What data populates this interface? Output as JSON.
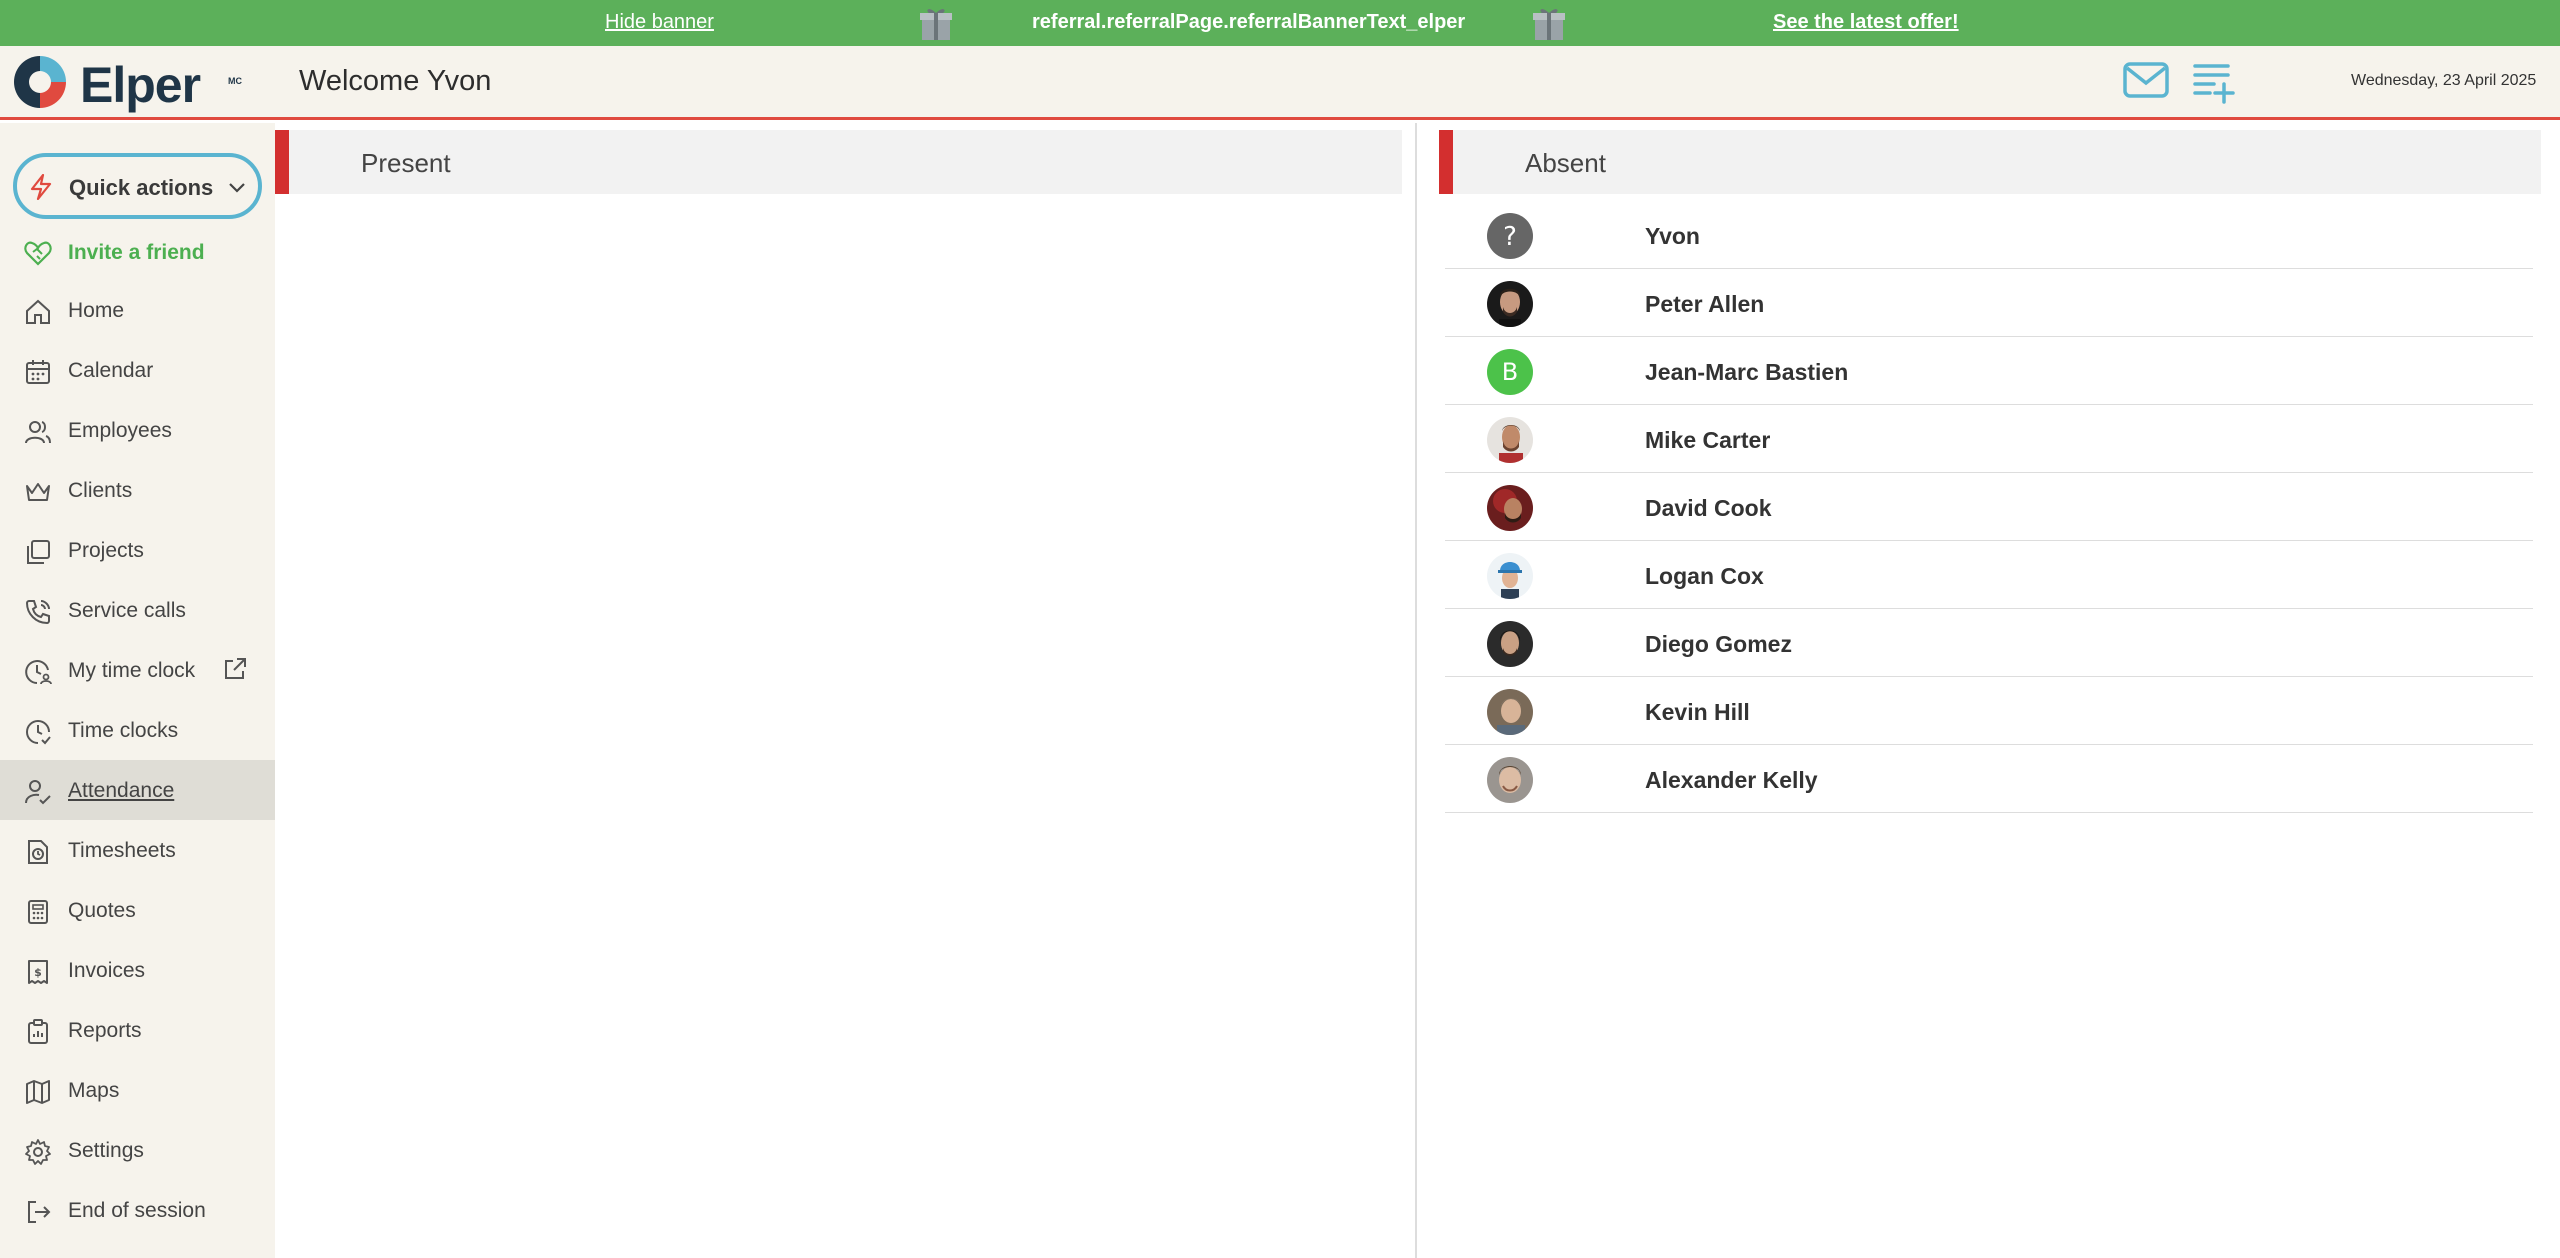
{
  "banner": {
    "hide_label": "Hide banner",
    "text": "referral.referralPage.referralBannerText_elper",
    "offer_label": "See the latest offer!",
    "color": "#5cb05a"
  },
  "header": {
    "logo_text": "Elper",
    "logo_mark": "MC",
    "welcome": "Welcome Yvon",
    "date": "Wednesday, 23 April 2025",
    "icons": [
      "mail-icon",
      "add-list-icon"
    ],
    "accent": "#5ab4d0"
  },
  "sidebar": {
    "quick_actions": "Quick actions",
    "invite": "Invite a friend",
    "items": [
      {
        "label": "Home",
        "icon": "home-icon"
      },
      {
        "label": "Calendar",
        "icon": "calendar-icon"
      },
      {
        "label": "Employees",
        "icon": "users-icon"
      },
      {
        "label": "Clients",
        "icon": "crown-icon"
      },
      {
        "label": "Projects",
        "icon": "folders-icon"
      },
      {
        "label": "Service calls",
        "icon": "phone-icon"
      },
      {
        "label": "My time clock",
        "icon": "clock-user-icon"
      },
      {
        "label": "Time clocks",
        "icon": "clock-icon"
      },
      {
        "label": "Attendance",
        "icon": "user-check-icon",
        "active": true
      },
      {
        "label": "Timesheets",
        "icon": "timesheet-icon"
      },
      {
        "label": "Quotes",
        "icon": "calculator-icon"
      },
      {
        "label": "Invoices",
        "icon": "invoice-icon"
      },
      {
        "label": "Reports",
        "icon": "clipboard-icon"
      },
      {
        "label": "Maps",
        "icon": "map-icon"
      },
      {
        "label": "Settings",
        "icon": "gear-icon"
      },
      {
        "label": "End of session",
        "icon": "logout-icon"
      }
    ]
  },
  "present": {
    "title": "Present"
  },
  "absent": {
    "title": "Absent",
    "employees": [
      {
        "name": "Yvon",
        "avatar": "unknown"
      },
      {
        "name": "Peter Allen",
        "avatar": "photo"
      },
      {
        "name": "Jean-Marc Bastien",
        "avatar": "initial",
        "initial": "B"
      },
      {
        "name": "Mike Carter",
        "avatar": "photo"
      },
      {
        "name": "David Cook",
        "avatar": "photo"
      },
      {
        "name": "Logan Cox",
        "avatar": "photo"
      },
      {
        "name": "Diego Gomez",
        "avatar": "photo"
      },
      {
        "name": "Kevin Hill",
        "avatar": "photo"
      },
      {
        "name": "Alexander Kelly",
        "avatar": "photo"
      }
    ]
  }
}
